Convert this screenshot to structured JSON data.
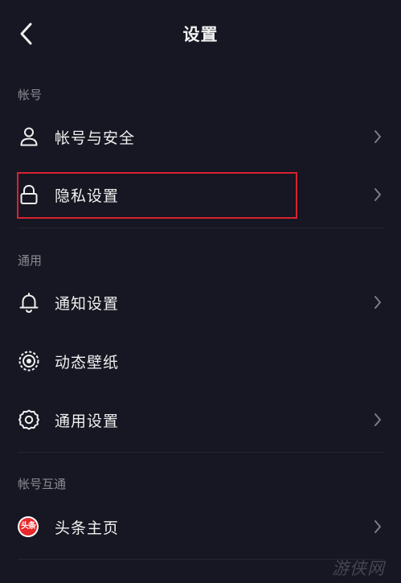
{
  "header": {
    "title": "设置",
    "back_icon": "chevron-left-icon"
  },
  "sections": [
    {
      "title": "帐号",
      "items": [
        {
          "label": "帐号与安全",
          "icon": "user-icon"
        },
        {
          "label": "隐私设置",
          "icon": "lock-icon",
          "highlighted": true
        }
      ]
    },
    {
      "title": "通用",
      "items": [
        {
          "label": "通知设置",
          "icon": "bell-icon"
        },
        {
          "label": "动态壁纸",
          "icon": "live-wallpaper-icon"
        },
        {
          "label": "通用设置",
          "icon": "gear-icon"
        }
      ]
    },
    {
      "title": "帐号互通",
      "items": [
        {
          "label": "头条主页",
          "icon": "toutiao-logo-icon",
          "badge_text": "头条"
        }
      ]
    }
  ],
  "colors": {
    "background": "#161722",
    "text": "#f0f0f0",
    "section_header": "#8a8b93",
    "highlight": "#d8232f",
    "toutiao_red": "#e8282b"
  },
  "watermark": {
    "text": "游侠网"
  }
}
